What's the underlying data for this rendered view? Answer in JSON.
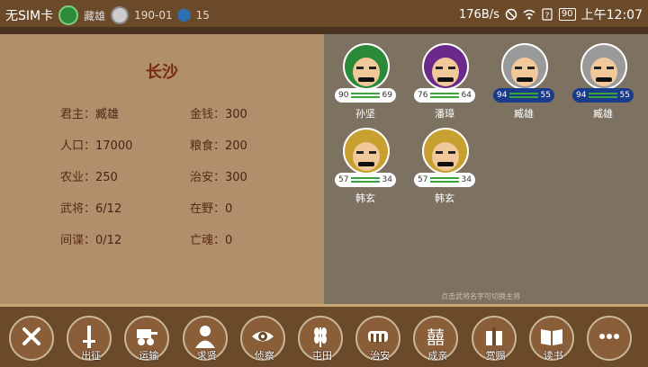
{
  "status_bar": {
    "carrier": "无SIM卡",
    "game_label": "藏雄",
    "level": "190-01",
    "gems": "15",
    "network_speed": "176B/s",
    "battery": "90",
    "clock": "上午12:07"
  },
  "city": {
    "name": "长沙",
    "stats": [
      {
        "label": "君主：",
        "value": "臧雄"
      },
      {
        "label": "金钱：",
        "value": "300"
      },
      {
        "label": "人口：",
        "value": "17000"
      },
      {
        "label": "粮食：",
        "value": "200"
      },
      {
        "label": "农业：",
        "value": "250"
      },
      {
        "label": "治安：",
        "value": "300"
      },
      {
        "label": "武将：",
        "value": "6/12"
      },
      {
        "label": "在野：",
        "value": "0"
      },
      {
        "label": "间谍：",
        "value": "0/12"
      },
      {
        "label": "亡魂：",
        "value": "0"
      }
    ]
  },
  "generals": [
    {
      "name": "孙坚",
      "left": "90",
      "right": "69",
      "style": "white",
      "helmet": "#2a8a3a"
    },
    {
      "name": "潘璋",
      "left": "76",
      "right": "64",
      "style": "white",
      "helmet": "#6a2a8a"
    },
    {
      "name": "臧雄",
      "left": "94",
      "right": "55",
      "style": "blue",
      "helmet": "#9a9a9a"
    },
    {
      "name": "臧雄",
      "left": "94",
      "right": "55",
      "style": "blue",
      "helmet": "#9a9a9a"
    },
    {
      "name": "韩玄",
      "left": "57",
      "right": "34",
      "style": "white",
      "helmet": "#c8a030"
    },
    {
      "name": "韩玄",
      "left": "57",
      "right": "34",
      "style": "white",
      "helmet": "#c8a030"
    }
  ],
  "hint": "点击武将名字可切换主将",
  "toolbar": {
    "buttons": [
      {
        "label": "",
        "icon": "close-icon"
      },
      {
        "label": "出征",
        "icon": "sword-icon"
      },
      {
        "label": "运输",
        "icon": "cart-icon"
      },
      {
        "label": "求贤",
        "icon": "person-icon"
      },
      {
        "label": "侦察",
        "icon": "eye-icon"
      },
      {
        "label": "屯田",
        "icon": "wheat-icon"
      },
      {
        "label": "治安",
        "icon": "shield-icon"
      },
      {
        "label": "成亲",
        "icon": "double-happiness-icon"
      },
      {
        "label": "赏赐",
        "icon": "gift-icon"
      },
      {
        "label": "读书",
        "icon": "book-icon"
      },
      {
        "label": "",
        "icon": "more-icon"
      }
    ]
  }
}
